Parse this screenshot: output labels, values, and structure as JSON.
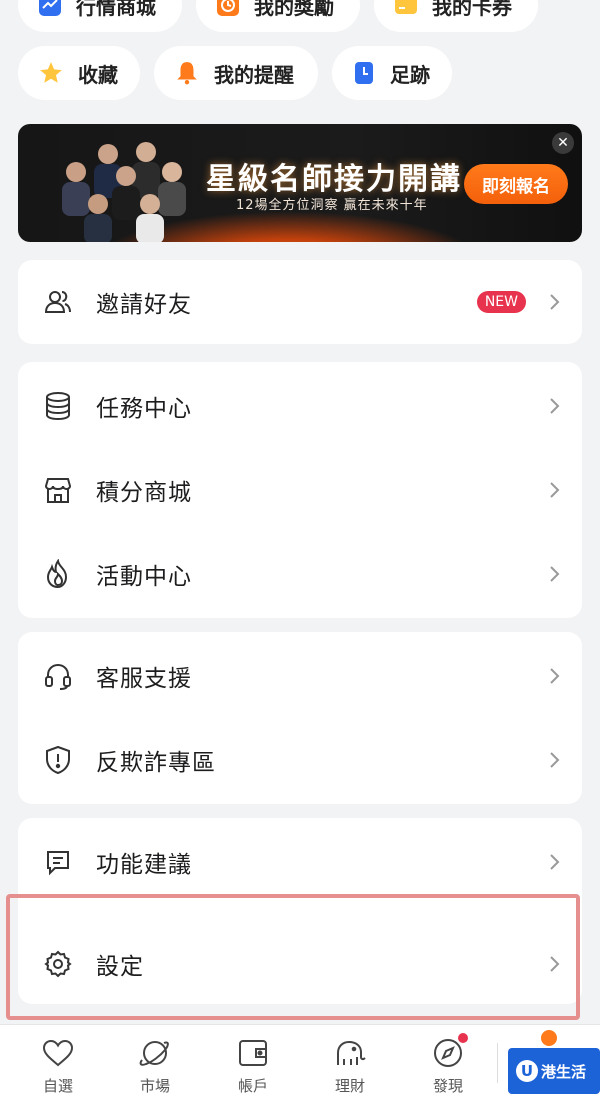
{
  "chips_top": [
    {
      "label": "行情商城",
      "icon": "chart-icon"
    },
    {
      "label": "我的獎勵",
      "icon": "clock-reward-icon"
    },
    {
      "label": "我的卡券",
      "icon": "coupon-icon"
    }
  ],
  "chips_mid": [
    {
      "label": "收藏",
      "icon": "star-icon"
    },
    {
      "label": "我的提醒",
      "icon": "bell-icon"
    },
    {
      "label": "足跡",
      "icon": "footprint-icon"
    }
  ],
  "banner": {
    "title": "星級名師接力開講",
    "subtitle": "12場全方位洞察 贏在未來十年",
    "cta": "即刻報名",
    "close": "✕"
  },
  "menu": {
    "invite": {
      "label": "邀請好友",
      "badge": "NEW"
    },
    "tasks": {
      "label": "任務中心"
    },
    "points": {
      "label": "積分商城"
    },
    "activity": {
      "label": "活動中心"
    },
    "support": {
      "label": "客服支援"
    },
    "antifraud": {
      "label": "反欺詐專區"
    },
    "feedback": {
      "label": "功能建議"
    },
    "settings": {
      "label": "設定"
    }
  },
  "tabs": [
    {
      "label": "自選",
      "icon": "heart-icon"
    },
    {
      "label": "市場",
      "icon": "planet-icon"
    },
    {
      "label": "帳戶",
      "icon": "wallet-icon"
    },
    {
      "label": "理財",
      "icon": "elephant-icon"
    },
    {
      "label": "發現",
      "icon": "compass-icon"
    }
  ],
  "watermark": {
    "logo": "U",
    "text": "港生活"
  },
  "colors": {
    "accent": "#f4600b",
    "badge": "#e8334e",
    "highlight": "#e58f8f"
  }
}
